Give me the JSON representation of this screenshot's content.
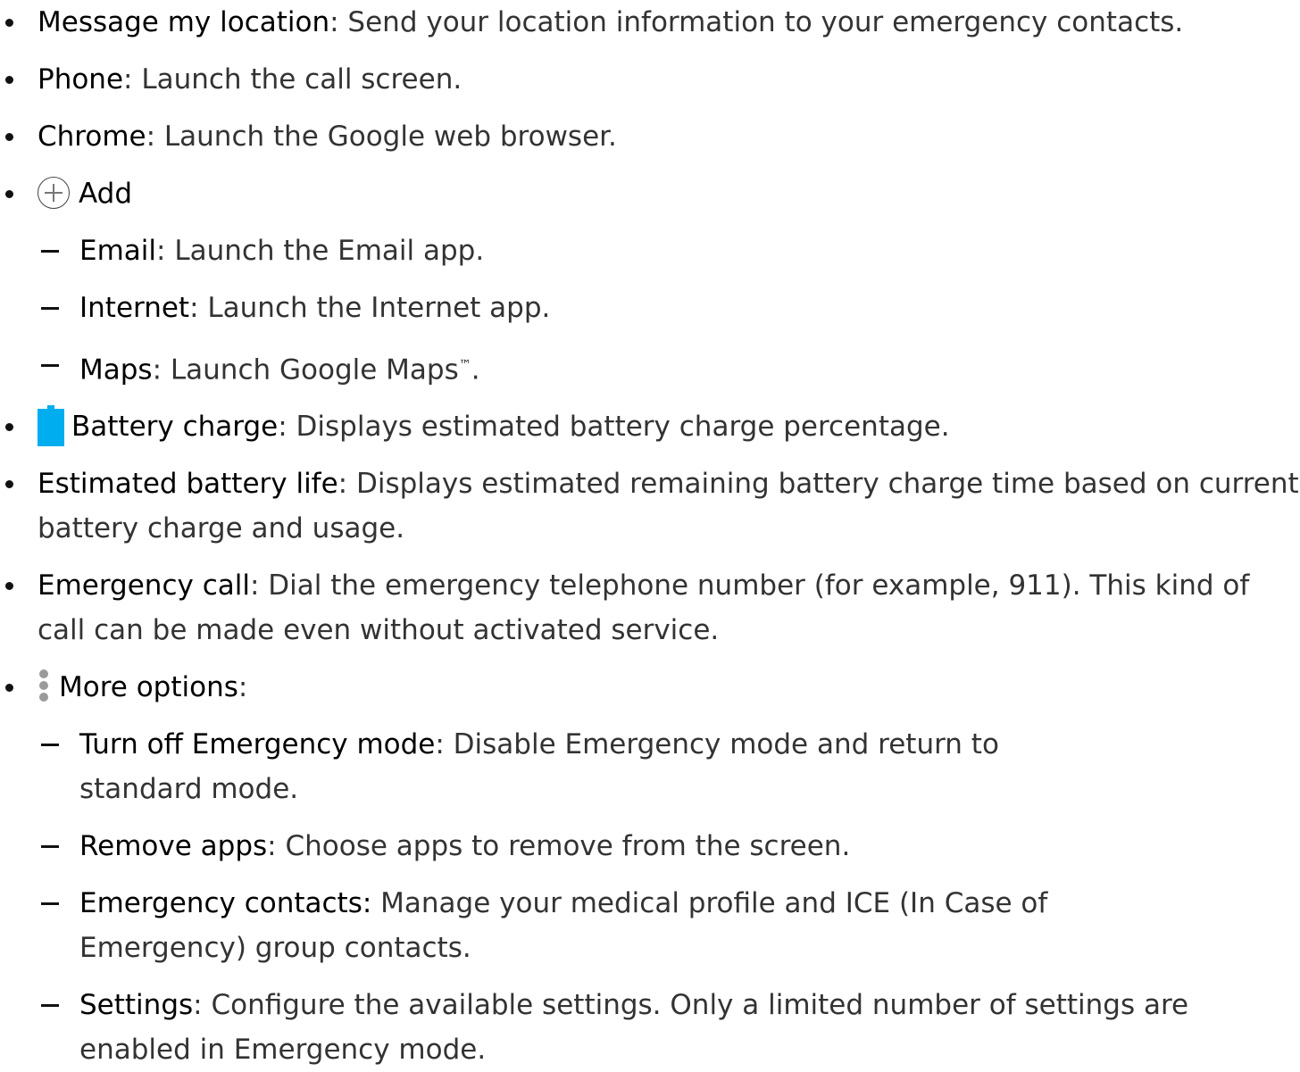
{
  "items": [
    {
      "term": "Message my location",
      "text": ": Send your location information to your emergency contacts."
    },
    {
      "term": "Phone",
      "text": ": Launch the call screen."
    },
    {
      "term": "Chrome",
      "text": ": Launch the Google web browser."
    },
    {
      "term": "Add",
      "text": ""
    },
    {
      "term": "Email",
      "text": ": Launch the Email app."
    },
    {
      "term": "Internet",
      "text": ": Launch the Internet app."
    },
    {
      "term": "Maps",
      "text": ": Launch Google Maps",
      "sup": "™",
      "after": "."
    },
    {
      "term": "Battery charge",
      "text": ": Displays estimated battery charge percentage."
    },
    {
      "term": "Estimated battery life",
      "text": ": Displays estimated remaining battery charge time based on current battery charge and usage."
    },
    {
      "term": "Emergency call",
      "text": ": Dial the emergency telephone number (for example, 911). This kind of call can be made even without activated service."
    },
    {
      "term": "More options",
      "text": ":"
    },
    {
      "term": "Turn off Emergency mode",
      "text": ": Disable Emergency mode and return to standard mode."
    },
    {
      "term": "Remove apps",
      "text": ": Choose apps to remove from the screen."
    },
    {
      "term": "Emergency contacts:",
      "text": " Manage your medical profile and ICE (In Case of Emergency) group contacts."
    },
    {
      "term": "Settings",
      "text": ": Configure the available settings. Only a limited number of settings are enabled in Emergency mode."
    }
  ],
  "icons": {
    "add": "plus-circle-icon",
    "battery": "battery-icon",
    "more": "more-options-icon"
  },
  "colors": {
    "battery": "#00aeef",
    "more_dots": "#9a9a9a"
  }
}
